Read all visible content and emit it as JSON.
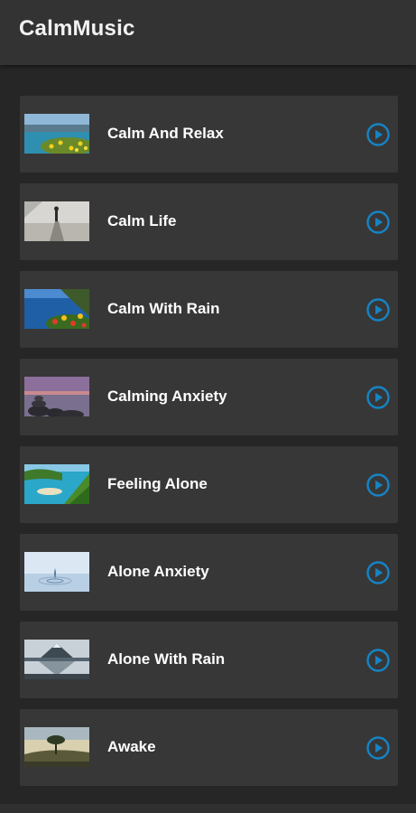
{
  "app": {
    "title": "CalmMusic"
  },
  "colors": {
    "app_bar": "#333333",
    "background": "#262626",
    "card": "#373737",
    "accent": "#1683c4",
    "text": "#ffffff"
  },
  "tracks": [
    {
      "title": "Calm And Relax",
      "thumbnail": "lake-flowers-icon"
    },
    {
      "title": "Calm Life",
      "thumbnail": "person-on-pier-icon"
    },
    {
      "title": "Calm With Rain",
      "thumbnail": "coast-flowers-icon"
    },
    {
      "title": "Calming Anxiety",
      "thumbnail": "stacked-stones-sunset-icon"
    },
    {
      "title": "Feeling Alone",
      "thumbnail": "tropical-bay-icon"
    },
    {
      "title": "Alone Anxiety",
      "thumbnail": "water-drop-icon"
    },
    {
      "title": "Alone With Rain",
      "thumbnail": "mountain-reflection-icon"
    },
    {
      "title": "Awake",
      "thumbnail": "lone-tree-sunrise-icon"
    }
  ],
  "icons": {
    "play": "play-circle-icon"
  }
}
